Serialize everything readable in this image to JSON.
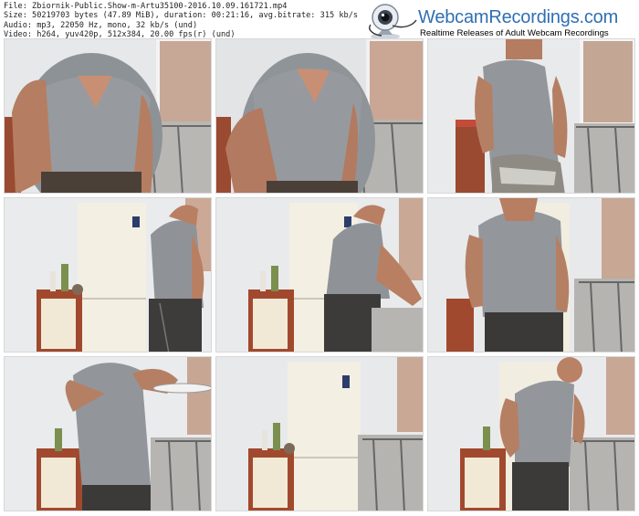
{
  "meta": {
    "file": "File: Zbiornik-Public.Show-m-Artu35100-2016.10.09.161721.mp4",
    "size": "Size: 50219703 bytes (47.89 MiB), duration: 00:21:16, avg.bitrate: 315 kb/s",
    "audio": "Audio: mp3, 22050 Hz, mono, 32 kb/s (und)",
    "video": "Video: h264, yuv420p, 512x384, 20.00 fps(r) (und)"
  },
  "logo": {
    "brand": "WebcamRecordings.com",
    "tagline": "Realtime Releases of Adult Webcam Recordings",
    "icon": "webcam-icon"
  },
  "thumbnails": [
    {
      "scene": "torso-close"
    },
    {
      "scene": "torso-close"
    },
    {
      "scene": "torso-center"
    },
    {
      "scene": "fridge-right"
    },
    {
      "scene": "fridge-right"
    },
    {
      "scene": "torso-center"
    },
    {
      "scene": "torso-left"
    },
    {
      "scene": "fridge-only"
    },
    {
      "scene": "side-right"
    }
  ]
}
